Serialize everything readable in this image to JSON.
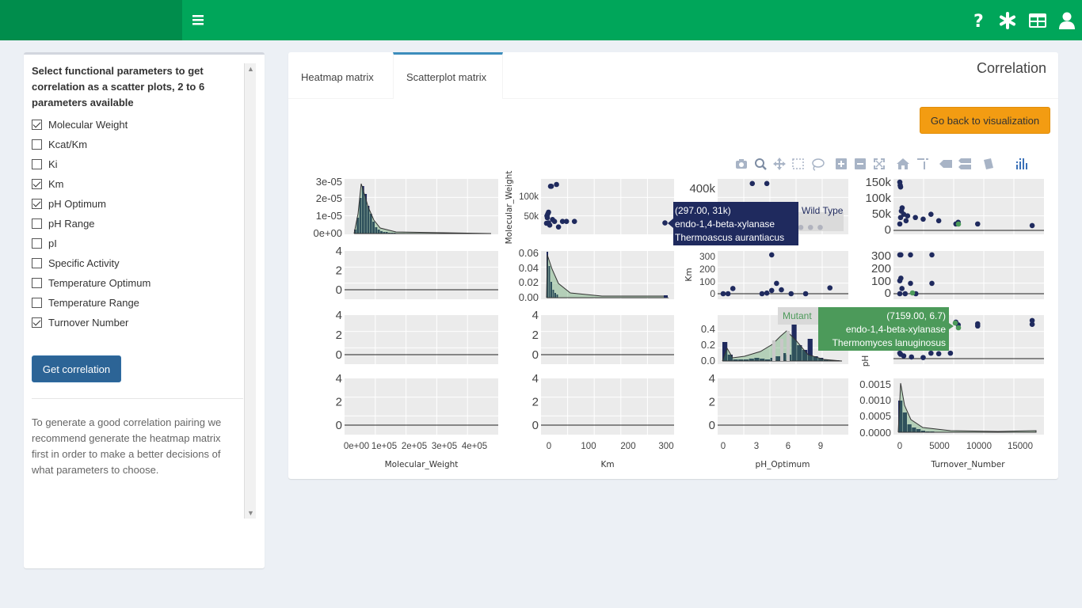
{
  "header": {
    "menu_icon": "bars-icon",
    "icons": [
      "question-icon",
      "asterisk-icon",
      "table-icon",
      "user-icon"
    ],
    "accent": "#00a65a",
    "brand_color": "#008d4c"
  },
  "sidebar": {
    "title": "Select functional parameters to get correlation as a scatter plots, 2 to 6 parameters available",
    "params": [
      {
        "label": "Molecular Weight",
        "checked": true
      },
      {
        "label": "Kcat/Km",
        "checked": false
      },
      {
        "label": "Ki",
        "checked": false
      },
      {
        "label": "Km",
        "checked": true
      },
      {
        "label": "pH Optimum",
        "checked": true
      },
      {
        "label": "pH Range",
        "checked": false
      },
      {
        "label": "pI",
        "checked": false
      },
      {
        "label": "Specific Activity",
        "checked": false
      },
      {
        "label": "Temperature Optimum",
        "checked": false
      },
      {
        "label": "Temperature Range",
        "checked": false
      },
      {
        "label": "Turnover Number",
        "checked": true
      }
    ],
    "button": "Get correlation",
    "help": "To generate a good correlation pairing we recommend generate the heatmap matrix first in order to make a better decisions of what parameters to choose."
  },
  "main": {
    "tabs": [
      {
        "label": "Heatmap matrix",
        "active": false
      },
      {
        "label": "Scatterplot matrix",
        "active": true
      }
    ],
    "title": "Correlation",
    "back_button": "Go back to visualization",
    "modebar": [
      "camera-icon",
      "zoom-icon",
      "pan-icon",
      "box-select-icon",
      "lasso-icon",
      "zoom-in-icon",
      "zoom-out-icon",
      "autoscale-icon",
      "home-icon",
      "spike-icon",
      "hover-closest-icon",
      "hover-compare-icon",
      "edit-icon",
      "plotly-logo-icon"
    ]
  },
  "chart_data": {
    "type": "scatter",
    "variables": [
      "Molecular_Weight",
      "Km",
      "pH_Optimum",
      "Turnover_Number"
    ],
    "series": [
      {
        "name": "Wild Type",
        "color": "#1f2a5e"
      },
      {
        "name": "Mutant",
        "color": "#4c9a5a"
      }
    ],
    "ticks": {
      "row1_col1_y": [
        "3e-05",
        "2e-05",
        "1e-05",
        "0e+00"
      ],
      "row1_col2_y": [
        "100k",
        "50k"
      ],
      "row1_col3_y": [
        "400k"
      ],
      "row1_col4_y": [
        "150k",
        "100k",
        "50k",
        "0"
      ],
      "row2_col2_y": [
        "0.06",
        "0.04",
        "0.02",
        "0.00"
      ],
      "row2_col3_y": [
        "300",
        "200",
        "100",
        "0"
      ],
      "row2_col4_y": [
        "300",
        "200",
        "100",
        "0"
      ],
      "row3_col3_y": [
        "0.4",
        "0.2",
        "0.0"
      ],
      "row4_col4_y": [
        "0.0015",
        "0.0010",
        "0.0005",
        "0.0000"
      ],
      "empty_y": [
        "4",
        "2",
        "0"
      ],
      "x_col1": [
        "0e+00",
        "1e+05",
        "2e+05",
        "3e+05",
        "4e+05"
      ],
      "x_col2": [
        "0",
        "100",
        "200",
        "300"
      ],
      "x_col3": [
        "0",
        "3",
        "6",
        "9"
      ],
      "x_col4": [
        "0",
        "5000",
        "10000",
        "15000"
      ]
    },
    "axis_labels_side": {
      "row1_col2": "Molecular_Weight",
      "row2_col3": "Km",
      "row3_col4": "pH"
    },
    "tooltips": [
      {
        "xy": "(297.00, 31k)",
        "enzyme": "endo-1,4-beta-xylanase",
        "organism": "Thermoascus aurantiacus",
        "series": "Wild Type"
      },
      {
        "xy": "(7159.00, 6.7)",
        "enzyme": "endo-1,4-beta-xylanase",
        "organism": "Thermomyces lanuginosus",
        "series": "Mutant"
      }
    ],
    "points": {
      "mw_vs_km": [
        [
          5,
          31
        ],
        [
          10,
          130
        ],
        [
          12,
          130
        ],
        [
          15,
          40
        ],
        [
          20,
          35
        ],
        [
          25,
          135
        ],
        [
          40,
          35
        ],
        [
          50,
          35
        ],
        [
          70,
          35
        ],
        [
          297,
          31
        ],
        [
          0,
          30
        ],
        [
          2,
          45
        ],
        [
          3,
          55
        ],
        [
          5,
          60
        ],
        [
          1,
          50
        ],
        [
          8,
          25
        ],
        [
          30,
          20
        ]
      ],
      "mw_vs_ph": [
        [
          4.5,
          440
        ],
        [
          3,
          440
        ],
        [
          5.5,
          60
        ],
        [
          6,
          60
        ],
        [
          7,
          60
        ],
        [
          8,
          60
        ],
        [
          9,
          60
        ],
        [
          10,
          60
        ],
        [
          6.5,
          55
        ],
        [
          7.5,
          45
        ]
      ],
      "mw_vs_turnover": [
        [
          0,
          150
        ],
        [
          50,
          140
        ],
        [
          100,
          135
        ],
        [
          200,
          60
        ],
        [
          500,
          50
        ],
        [
          1000,
          45
        ],
        [
          2000,
          40
        ],
        [
          3000,
          35
        ],
        [
          4000,
          50
        ],
        [
          5000,
          30
        ],
        [
          7200,
          20
        ],
        [
          7500,
          25
        ],
        [
          10000,
          20
        ],
        [
          17000,
          15
        ],
        [
          0,
          20
        ],
        [
          100,
          40
        ],
        [
          300,
          70
        ],
        [
          800,
          30
        ]
      ],
      "km_vs_ph": [
        [
          0,
          0
        ],
        [
          0.5,
          0
        ],
        [
          1,
          40
        ],
        [
          4,
          0
        ],
        [
          5,
          25
        ],
        [
          5,
          300
        ],
        [
          6,
          30
        ],
        [
          7,
          0
        ],
        [
          8.5,
          0
        ],
        [
          11,
          45
        ],
        [
          5.5,
          80
        ],
        [
          4.5,
          5
        ]
      ],
      "km_vs_turnover": [
        [
          0,
          300
        ],
        [
          100,
          300
        ],
        [
          1000,
          300
        ],
        [
          3000,
          300
        ],
        [
          0,
          100
        ],
        [
          100,
          120
        ],
        [
          1000,
          80
        ],
        [
          3000,
          80
        ],
        [
          0,
          0
        ],
        [
          200,
          40
        ],
        [
          500,
          0
        ],
        [
          1500,
          0
        ]
      ],
      "ph_vs_turnover": [
        [
          0,
          1
        ],
        [
          100,
          0.8
        ],
        [
          500,
          0.5
        ],
        [
          1500,
          0.3
        ],
        [
          3000,
          0.2
        ],
        [
          4000,
          1.0
        ],
        [
          5000,
          0.9
        ],
        [
          6500,
          1
        ],
        [
          7200,
          6.7
        ],
        [
          7500,
          6.2
        ],
        [
          10000,
          6.4
        ],
        [
          17000,
          6.3
        ],
        [
          10000,
          6
        ],
        [
          17000,
          7
        ]
      ]
    }
  }
}
